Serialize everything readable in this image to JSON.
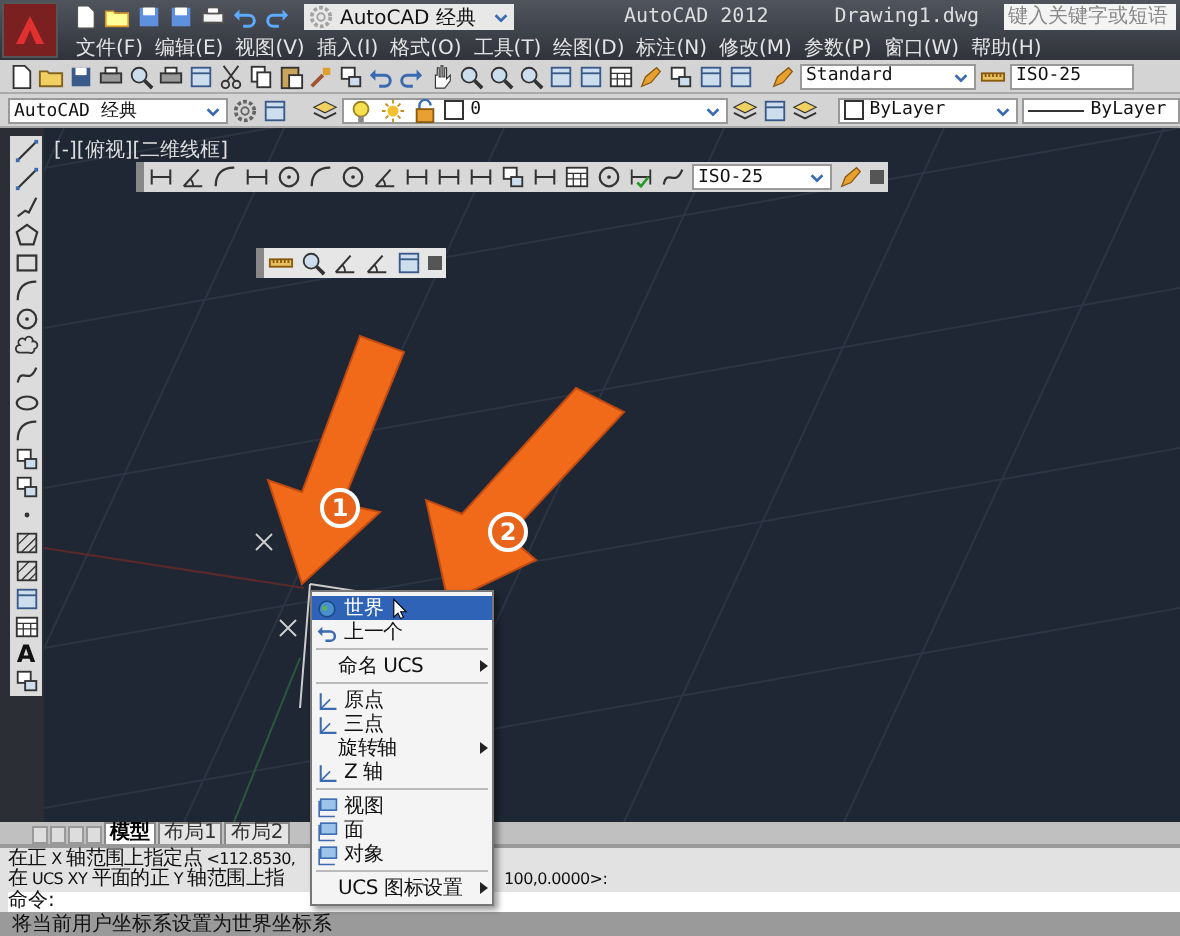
{
  "title_bar": {
    "workspace": "AutoCAD 经典",
    "app_title": "AutoCAD 2012",
    "file_name": "Drawing1.dwg",
    "search": {
      "placeholder": "键入关键字或短语"
    }
  },
  "menu_bar": [
    "文件(F)",
    "编辑(E)",
    "视图(V)",
    "插入(I)",
    "格式(O)",
    "工具(T)",
    "绘图(D)",
    "标注(N)",
    "修改(M)",
    "参数(P)",
    "窗口(W)",
    "帮助(H)"
  ],
  "styles_toolbar": {
    "text_style": "Standard",
    "dim_style": "ISO-25"
  },
  "layers_toolbar": {
    "workspace": "AutoCAD 经典",
    "layer": "0",
    "color_setting": "ByLayer",
    "linetype": "ByLayer"
  },
  "viewport_label": "[-][俯视][二维线框]",
  "dimension_toolbar": {
    "dim_style": "ISO-25"
  },
  "draw_toolbar": {
    "text_tool": "A"
  },
  "callouts": [
    "1",
    "2"
  ],
  "context_menu": [
    {
      "kind": "icon_item",
      "label": "世界",
      "selected": true,
      "submenu": false
    },
    {
      "kind": "icon_item",
      "label": "上一个",
      "selected": false,
      "submenu": false
    },
    {
      "kind": "separator"
    },
    {
      "kind": "item",
      "label": "命名 UCS",
      "selected": false,
      "submenu": true
    },
    {
      "kind": "separator"
    },
    {
      "kind": "icon_item",
      "label": "原点",
      "selected": false,
      "submenu": false
    },
    {
      "kind": "icon_item",
      "label": "三点",
      "selected": false,
      "submenu": false
    },
    {
      "kind": "item",
      "label": "旋转轴",
      "selected": false,
      "submenu": true
    },
    {
      "kind": "icon_item",
      "label": "Z 轴",
      "selected": false,
      "submenu": false
    },
    {
      "kind": "separator"
    },
    {
      "kind": "icon_item",
      "label": "视图",
      "selected": false,
      "submenu": false
    },
    {
      "kind": "icon_item",
      "label": "面",
      "selected": false,
      "submenu": false
    },
    {
      "kind": "icon_item",
      "label": "对象",
      "selected": false,
      "submenu": false
    },
    {
      "kind": "separator"
    },
    {
      "kind": "item",
      "label": "UCS 图标设置",
      "selected": false,
      "submenu": true
    }
  ],
  "layout_tabs": [
    {
      "label": "模型",
      "selected": true
    },
    {
      "label": "布局1",
      "selected": false
    },
    {
      "label": "布局2",
      "selected": false
    }
  ],
  "command_line": {
    "history": [
      {
        "left": "在正 X 轴范围上指定点 <112.8530,"
      },
      {
        "left": "在 UCS XY 平面的正 Y 轴范围上指",
        "right": "100,0.0000>:"
      }
    ],
    "prompt": "命令:"
  },
  "status_bar": "将当前用户坐标系设置为世界坐标系"
}
